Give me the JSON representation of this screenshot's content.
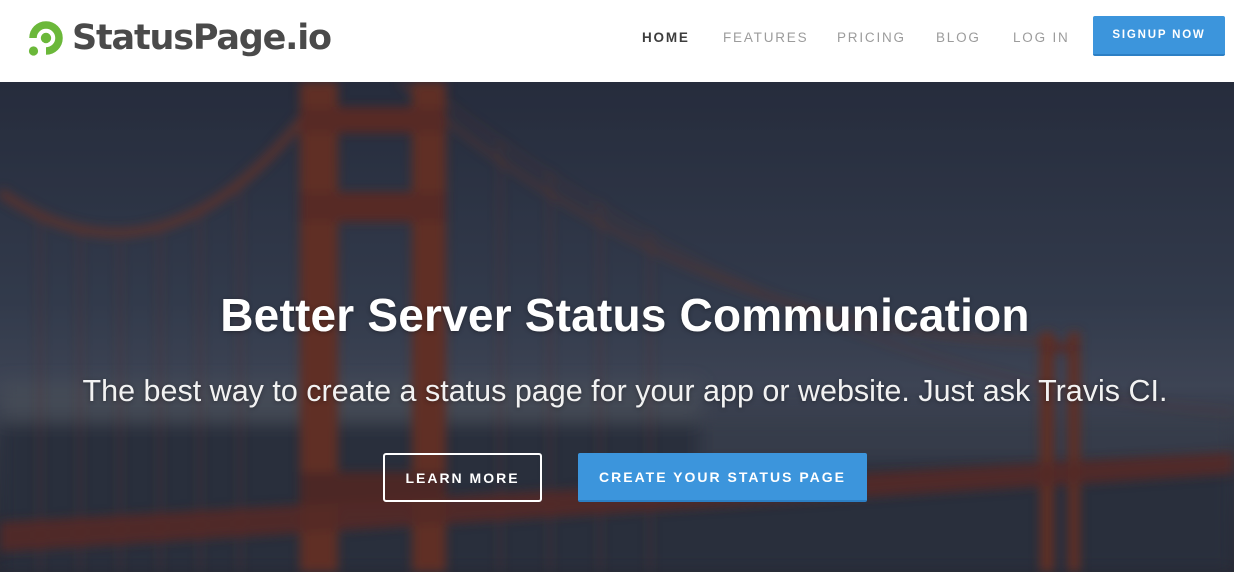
{
  "header": {
    "brand": "StatusPage.io",
    "logo_icon": "statuspage-logo-icon",
    "nav": {
      "home": "HOME",
      "features": "FEATURES",
      "pricing": "PRICING",
      "blog": "BLOG",
      "login": "LOG IN"
    },
    "active_nav": "HOME",
    "signup_label": "SIGNUP NOW"
  },
  "hero": {
    "title": "Better Server Status Communication",
    "subtitle": "The best way to create a status page for your app or website. Just ask Travis CI.",
    "learn_more_label": "LEARN MORE",
    "create_label": "CREATE YOUR STATUS PAGE",
    "background": "golden-gate-bridge-photo"
  },
  "colors": {
    "brand_green": "#6bb83a",
    "accent_blue": "#3c95dc",
    "text_dark": "#4a4a4a",
    "nav_gray": "#9c9c9c"
  }
}
